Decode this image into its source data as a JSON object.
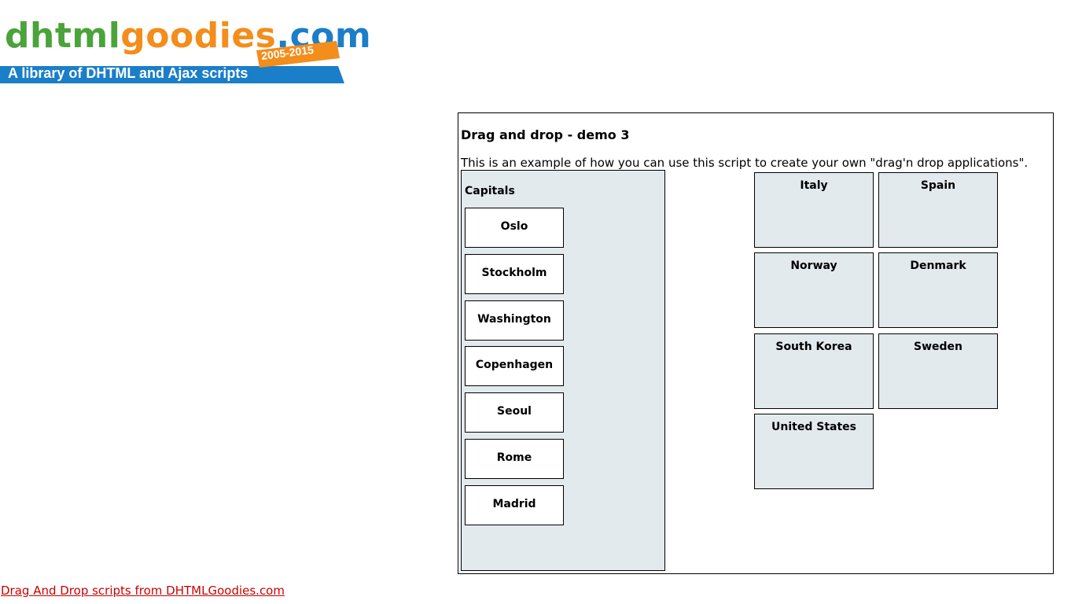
{
  "logo": {
    "word_part1": "dhtml",
    "word_part2": "goodies",
    "word_part3": ".com",
    "years": "2005-2015",
    "tagline": "A library of DHTML and Ajax scripts",
    "colors": {
      "green": "#4ba33b",
      "orange": "#f38d1b",
      "blue": "#1b7ec8"
    }
  },
  "demo": {
    "title": "Drag and drop - demo 3",
    "description": "This is an example of how you can use this script to create your own \"drag'n drop applications\".",
    "capitals_label": "Capitals",
    "capitals": [
      "Oslo",
      "Stockholm",
      "Washington",
      "Copenhagen",
      "Seoul",
      "Rome",
      "Madrid"
    ],
    "countries": [
      "Italy",
      "Spain",
      "Norway",
      "Denmark",
      "South Korea",
      "Sweden",
      "United States"
    ],
    "colors": {
      "panel_bg": "#e2eaed",
      "border": "#000000"
    }
  },
  "footer": {
    "link_text": "Drag And Drop scripts from DHTMLGoodies.com",
    "link_color": "#cc0000"
  }
}
